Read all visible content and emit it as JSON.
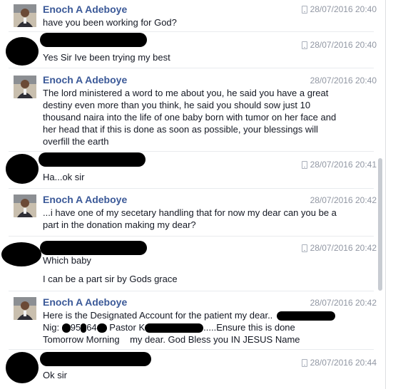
{
  "messages": [
    {
      "sender": "Enoch A Adeboye",
      "timestamp": "28/07/2016 20:40",
      "mobile": true,
      "lines": [
        "have you been working for God?"
      ]
    },
    {
      "sender": "",
      "timestamp": "28/07/2016 20:40",
      "mobile": true,
      "redacted_sender": true,
      "lines": [
        "Yes Sir Ive been trying my best"
      ]
    },
    {
      "sender": "Enoch A Adeboye",
      "timestamp": "28/07/2016 20:40",
      "mobile": false,
      "lines": [
        "The lord ministered a word to me about you, he said you have a great",
        "destiny even more than you think, he said you should sow just 10",
        "thousand naira into the life of one baby born with tumor on her face and",
        "her head that if this is done as soon as possible, your blessings will",
        "overfill the earth"
      ]
    },
    {
      "sender": "",
      "timestamp": "28/07/2016 20:41",
      "mobile": true,
      "redacted_sender": true,
      "lines": [
        "Ha...ok sir"
      ]
    },
    {
      "sender": "Enoch A Adeboye",
      "timestamp": "28/07/2016 20:42",
      "mobile": false,
      "lines": [
        "...i have one of my secetary handling that for now my dear can you be a",
        "part in the donation making my dear?"
      ]
    },
    {
      "sender": "",
      "timestamp": "28/07/2016 20:42",
      "mobile": true,
      "redacted_sender": true,
      "lines": [
        "Which baby",
        "",
        "I can be a part sir by Gods grace"
      ]
    },
    {
      "sender": "Enoch A Adeboye",
      "timestamp": "28/07/2016 20:42",
      "mobile": false,
      "lines": [
        "Here is the Designated Account for the patient my dear..",
        "Nig: ",
        "Tomorrow Morning    my dear. God Bless you IN JESUS Name"
      ],
      "line2_parts": [
        "Nig: ",
        "9",
        "5",
        "64",
        " Pastor K",
        ".....Ensure this is done"
      ]
    },
    {
      "sender": "",
      "timestamp": "28/07/2016 20:44",
      "mobile": true,
      "redacted_sender": true,
      "lines": [
        "Ok sir"
      ]
    }
  ],
  "colors": {
    "name": "#3b5998",
    "timestamp": "#9197a3",
    "text": "#141823",
    "redaction": "#000000"
  },
  "icons": {
    "mobile": "mobile-phone-icon",
    "avatar": "profile-photo"
  }
}
